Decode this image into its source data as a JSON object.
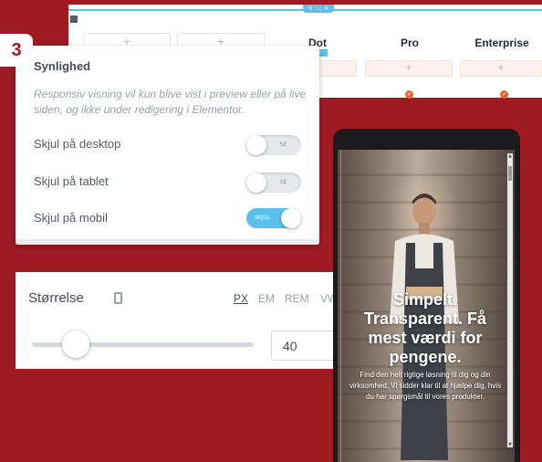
{
  "pricing": {
    "plans": [
      "Dot",
      "Pro",
      "Enterprise"
    ],
    "add_symbol": "+",
    "handle_text": "+ ::: ×",
    "selected_tag": "::: ×",
    "check_symbol": "✔"
  },
  "step_badge": "3",
  "visibility": {
    "title": "Synlighed",
    "description": "Responsiv visning vil kun blive vist i preview eller på live siden, og ikke under redigering i Elementor.",
    "options": [
      {
        "label": "Skjul på desktop",
        "toggle_text": "SE",
        "on": false
      },
      {
        "label": "Skjul på tablet",
        "toggle_text": "SE",
        "on": false
      },
      {
        "label": "Skjul på mobil",
        "toggle_text": "SKJUL",
        "on": true
      }
    ]
  },
  "size": {
    "label": "Størrelse",
    "units": [
      "PX",
      "EM",
      "REM",
      "VW"
    ],
    "active_unit": "PX",
    "value": "40",
    "slider_level": 0.18
  },
  "preview": {
    "headline": "Simpelt. Transparent. Få mest værdi for pengene.",
    "subtext": "Find den helt rigtige løsning til dig og din virksomhed. Vi sidder klar til at hjælpe dig, hvis du har spørgsmål til vores produkter."
  },
  "colors": {
    "background": "#9e1b22",
    "accent": "#5bc0eb",
    "check": "#f0602c"
  }
}
